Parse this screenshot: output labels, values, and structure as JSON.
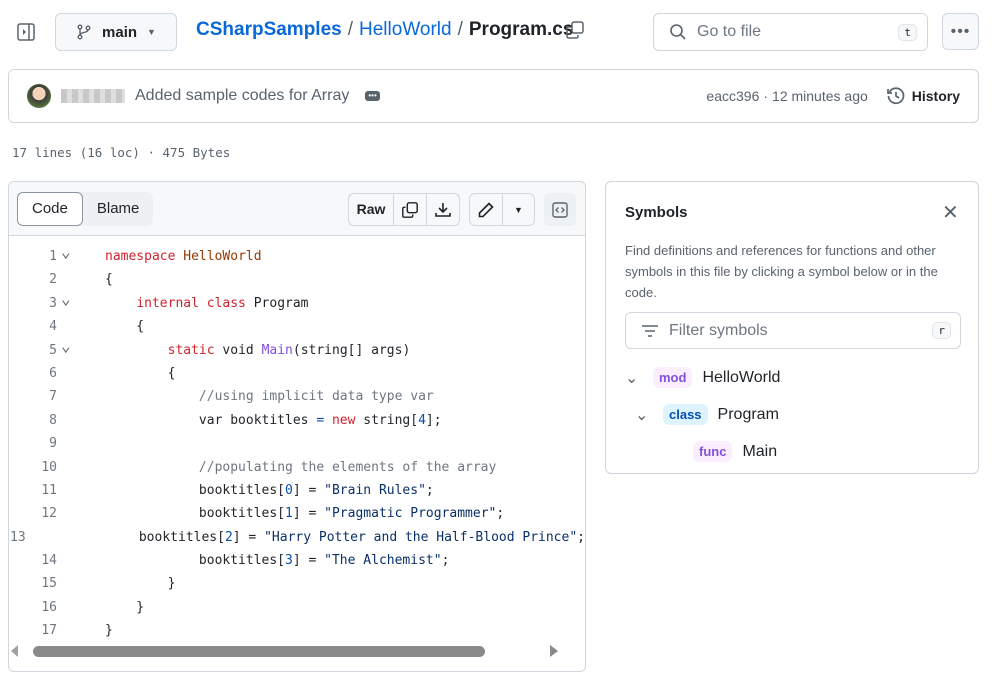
{
  "header": {
    "branch": "main",
    "breadcrumb": {
      "repo": "CSharpSamples",
      "folder": "HelloWorld",
      "file": "Program.cs",
      "separator": "/"
    },
    "search_placeholder": "Go to file",
    "search_shortcut": "t"
  },
  "commit": {
    "message": "Added sample codes for Array",
    "sha": "eacc396",
    "time": "12 minutes ago",
    "separator": "·",
    "history_label": "History"
  },
  "file_info": "17 lines (16 loc) · 475 Bytes",
  "toolbar": {
    "tabs": [
      {
        "label": "Code",
        "active": true
      },
      {
        "label": "Blame",
        "active": false
      }
    ],
    "raw_label": "Raw"
  },
  "code": {
    "lines": [
      {
        "n": "1",
        "fold": true,
        "tokens": [
          [
            "kw",
            "namespace "
          ],
          [
            "ent",
            "HelloWorld"
          ]
        ]
      },
      {
        "n": "2",
        "fold": false,
        "tokens": [
          [
            "",
            "{"
          ]
        ]
      },
      {
        "n": "3",
        "fold": true,
        "tokens": [
          [
            "",
            "    "
          ],
          [
            "kw",
            "internal class "
          ],
          [
            "",
            "Program"
          ]
        ]
      },
      {
        "n": "4",
        "fold": false,
        "tokens": [
          [
            "",
            "    {"
          ]
        ]
      },
      {
        "n": "5",
        "fold": true,
        "tokens": [
          [
            "",
            "        "
          ],
          [
            "kw",
            "static "
          ],
          [
            "",
            "void "
          ],
          [
            "fn",
            "Main"
          ],
          [
            "",
            "(string[] args)"
          ]
        ]
      },
      {
        "n": "6",
        "fold": false,
        "tokens": [
          [
            "",
            "        {"
          ]
        ]
      },
      {
        "n": "7",
        "fold": false,
        "tokens": [
          [
            "",
            "            "
          ],
          [
            "cm",
            "//using implicit data type var"
          ]
        ]
      },
      {
        "n": "8",
        "fold": false,
        "tokens": [
          [
            "",
            "            var booktitles "
          ],
          [
            "op",
            "="
          ],
          [
            "kw",
            " new"
          ],
          [
            "",
            " string["
          ],
          [
            "num",
            "4"
          ],
          [
            "",
            "];"
          ]
        ]
      },
      {
        "n": "9",
        "fold": false,
        "tokens": []
      },
      {
        "n": "10",
        "fold": false,
        "tokens": [
          [
            "",
            "            "
          ],
          [
            "cm",
            "//populating the elements of the array"
          ]
        ]
      },
      {
        "n": "11",
        "fold": false,
        "tokens": [
          [
            "",
            "            booktitles["
          ],
          [
            "num",
            "0"
          ],
          [
            "",
            "] = "
          ],
          [
            "st",
            "\"Brain Rules\""
          ],
          [
            "",
            ";"
          ]
        ]
      },
      {
        "n": "12",
        "fold": false,
        "tokens": [
          [
            "",
            "            booktitles["
          ],
          [
            "num",
            "1"
          ],
          [
            "",
            "] = "
          ],
          [
            "st",
            "\"Pragmatic Programmer\""
          ],
          [
            "",
            ";"
          ]
        ]
      },
      {
        "n": "13",
        "fold": false,
        "tokens": [
          [
            "",
            "            booktitles["
          ],
          [
            "num",
            "2"
          ],
          [
            "",
            "] = "
          ],
          [
            "st",
            "\"Harry Potter and the Half-Blood Prince\""
          ],
          [
            "",
            ";"
          ]
        ]
      },
      {
        "n": "14",
        "fold": false,
        "tokens": [
          [
            "",
            "            booktitles["
          ],
          [
            "num",
            "3"
          ],
          [
            "",
            "] = "
          ],
          [
            "st",
            "\"The Alchemist\""
          ],
          [
            "",
            ";"
          ]
        ]
      },
      {
        "n": "15",
        "fold": false,
        "tokens": [
          [
            "",
            "        }"
          ]
        ]
      },
      {
        "n": "16",
        "fold": false,
        "tokens": [
          [
            "",
            "    }"
          ]
        ]
      },
      {
        "n": "17",
        "fold": false,
        "tokens": [
          [
            "",
            "}"
          ]
        ]
      }
    ]
  },
  "symbols": {
    "title": "Symbols",
    "description": "Find definitions and references for functions and other symbols in this file by clicking a symbol below or in the code.",
    "filter_placeholder": "Filter symbols",
    "filter_shortcut": "r",
    "items": [
      {
        "kind": "mod",
        "name": "HelloWorld",
        "color": "#8250df",
        "bg": "#fbefff"
      },
      {
        "kind": "class",
        "name": "Program",
        "color": "#0550ae",
        "bg": "#ddf4ff"
      },
      {
        "kind": "func",
        "name": "Main",
        "color": "#8250df",
        "bg": "#fbefff"
      }
    ]
  },
  "colors": {
    "link": "#0969da",
    "keyword": "#cf222e",
    "function": "#8250df",
    "string": "#0a3069",
    "comment": "#6e7781"
  }
}
